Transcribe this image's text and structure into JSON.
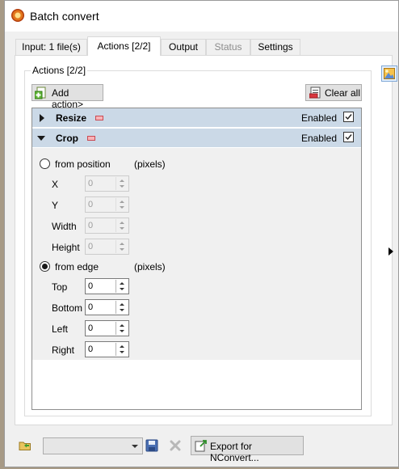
{
  "window": {
    "title": "Batch convert"
  },
  "tabs": [
    {
      "label": "Input: 1 file(s)",
      "state": "normal"
    },
    {
      "label": "Actions [2/2]",
      "state": "active"
    },
    {
      "label": "Output",
      "state": "normal"
    },
    {
      "label": "Status",
      "state": "disabled"
    },
    {
      "label": "Settings",
      "state": "normal"
    }
  ],
  "actions_group": {
    "title": "Actions [2/2]",
    "add_action_label": "Add action>",
    "clear_all_label": "Clear all"
  },
  "actions": [
    {
      "name": "Resize",
      "expanded": false,
      "enabled_label": "Enabled",
      "enabled": true
    },
    {
      "name": "Crop",
      "expanded": true,
      "enabled_label": "Enabled",
      "enabled": true
    }
  ],
  "crop": {
    "from_position": {
      "label": "from position",
      "unit": "(pixels)",
      "selected": false,
      "fields": [
        {
          "label": "X",
          "value": "0"
        },
        {
          "label": "Y",
          "value": "0"
        },
        {
          "label": "Width",
          "value": "0"
        },
        {
          "label": "Height",
          "value": "0"
        }
      ]
    },
    "from_edge": {
      "label": "from edge",
      "unit": "(pixels)",
      "selected": true,
      "fields": [
        {
          "label": "Top",
          "value": "0"
        },
        {
          "label": "Bottom",
          "value": "0"
        },
        {
          "label": "Left",
          "value": "0"
        },
        {
          "label": "Right",
          "value": "0"
        }
      ]
    }
  },
  "bottom_bar": {
    "preset_value": "",
    "export_label": "Export for NConvert..."
  },
  "icons": {
    "app": "xnview-app-icon",
    "add_action": "add-icon",
    "clear_all": "clear-list-icon",
    "collapse": "minus-icon",
    "open_preset": "open-folder-icon",
    "save_preset": "save-icon",
    "delete_preset": "delete-icon",
    "export": "export-icon",
    "preview": "image-preview-icon",
    "expand_right": "chevron-right-icon"
  },
  "colors": {
    "action_header": "#cbd9e7",
    "panel_bg": "#ffffff",
    "window_bg": "#f0f0f0"
  }
}
